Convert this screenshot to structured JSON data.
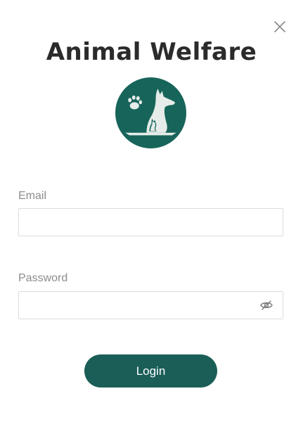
{
  "dialog": {
    "title": "Animal Welfare",
    "close_icon": "close-icon",
    "logo_icon": "animal-welfare-logo"
  },
  "form": {
    "email_label": "Email",
    "email_value": "",
    "email_placeholder": "",
    "password_label": "Password",
    "password_value": "",
    "password_placeholder": "",
    "password_toggle_icon": "eye-slash-icon",
    "login_label": "Login"
  },
  "colors": {
    "brand": "#1a5e57",
    "logo_bg": "#17645a",
    "title": "#2b2b2b",
    "label": "#8d8d8d",
    "border": "#dcdcdc"
  }
}
